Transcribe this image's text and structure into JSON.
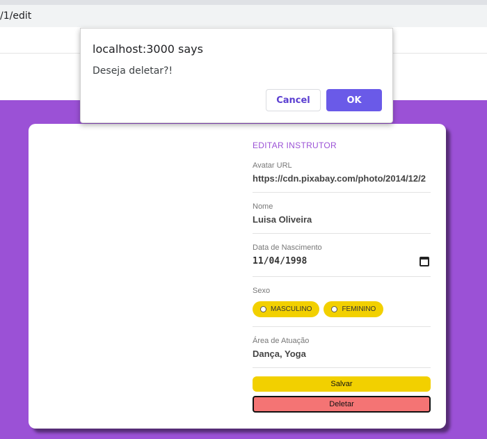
{
  "browser": {
    "url_fragment": "/1/edit"
  },
  "form": {
    "title": "EDITAR INSTRUTOR",
    "avatar_label": "Avatar URL",
    "avatar_value": "https://cdn.pixabay.com/photo/2014/12/2",
    "name_label": "Nome",
    "name_value": "Luisa Oliveira",
    "birth_label": "Data de Nascimento",
    "birth_value": "11/04/1998",
    "gender_label": "Sexo",
    "gender_options": [
      "MASCULINO",
      "FEMININO"
    ],
    "area_label": "Área de Atuação",
    "area_value": "Dança, Yoga",
    "save_label": "Salvar",
    "delete_label": "Deletar"
  },
  "dialog": {
    "title": "localhost:3000 says",
    "message": "Deseja deletar?!",
    "cancel_label": "Cancel",
    "ok_label": "OK"
  },
  "colors": {
    "page_purple": "#9b51d6",
    "save_yellow": "#f2d000",
    "delete_red": "#f47474",
    "ok_button": "#6a5ae8"
  },
  "icons": {
    "date_picker": "calendar-icon"
  }
}
